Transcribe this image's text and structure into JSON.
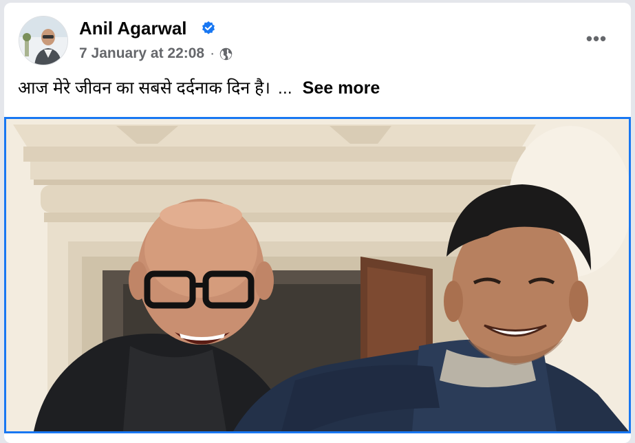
{
  "post": {
    "author": "Anil Agarwal",
    "verified_icon": "verified-badge-icon",
    "date": "7 January at 22:08",
    "separator": "·",
    "audience_icon": "globe-icon",
    "more_options": "•••",
    "text": "आज मेरे जीवन का सबसे दर्दनाक दिन है।",
    "ellipsis": "...",
    "see_more": "See more"
  },
  "colors": {
    "accent": "#1877f2",
    "secondary_text": "#65676b",
    "primary_text": "#050505"
  }
}
